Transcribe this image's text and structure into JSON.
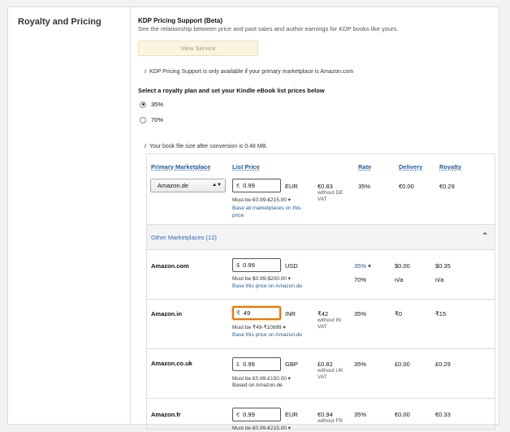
{
  "section_title": "Royalty and Pricing",
  "kdp": {
    "title": "KDP Pricing Support (Beta)",
    "description": "See the relationship between price and past sales and author earnings for KDP books like yours.",
    "view_button": "View Service",
    "info_note": "KDP Pricing Support is only available if your primary marketplace is Amazon.com"
  },
  "plan": {
    "label": "Select a royalty plan and set your Kindle eBook list prices below",
    "options": [
      "35%",
      "70%"
    ],
    "selected": "35%"
  },
  "file_size_note": "Your book file size after conversion is 0.48 MB.",
  "headers": {
    "primary_marketplace": "Primary Marketplace",
    "list_price": "List Price",
    "rate": "Rate",
    "delivery": "Delivery",
    "royalty": "Royalty"
  },
  "primary": {
    "marketplace": "Amazon.de",
    "symbol": "€",
    "price": "0.99",
    "currency": "EUR",
    "converted": "€0.83",
    "converted_note_1": "without DE",
    "converted_note_2": "VAT",
    "range": "Must be €0.99-€215.00",
    "link": "Base all marketplaces on this price",
    "rate": "35%",
    "delivery": "€0.00",
    "royalty": "€0.29"
  },
  "other_marketplaces_label": "Other Marketplaces (12)",
  "rows": [
    {
      "marketplace": "Amazon.com",
      "symbol": "$",
      "price": "0.99",
      "currency": "USD",
      "range": "Must be $0.99-$200.00",
      "link": "Base this price on Amazon.de",
      "rate": "35%",
      "rate2": "70%",
      "delivery": "$0.00",
      "delivery2": "n/a",
      "royalty": "$0.35",
      "royalty2": "n/a"
    },
    {
      "marketplace": "Amazon.in",
      "symbol": "₹",
      "price": "49",
      "currency": "INR",
      "converted": "₹42",
      "converted_note_1": "without IN",
      "converted_note_2": "VAT",
      "range": "Must be ₹49-₹10999",
      "link": "Base this price on Amazon.de",
      "rate": "35%",
      "delivery": "₹0",
      "royalty": "₹15"
    },
    {
      "marketplace": "Amazon.co.uk",
      "symbol": "£",
      "price": "0.99",
      "currency": "GBP",
      "converted": "£0.82",
      "converted_note_1": "without UK",
      "converted_note_2": "VAT",
      "range": "Must be £0.99-£150.00",
      "based_on": "Based on Amazon.de",
      "rate": "35%",
      "delivery": "£0.00",
      "royalty": "£0.29"
    },
    {
      "marketplace": "Amazon.fr",
      "symbol": "€",
      "price": "0.99",
      "currency": "EUR",
      "converted": "€0.94",
      "converted_note_1": "without FR",
      "range": "Must be €0.99-€215.00",
      "rate": "35%",
      "delivery": "€0.00",
      "royalty": "€0.33"
    }
  ]
}
